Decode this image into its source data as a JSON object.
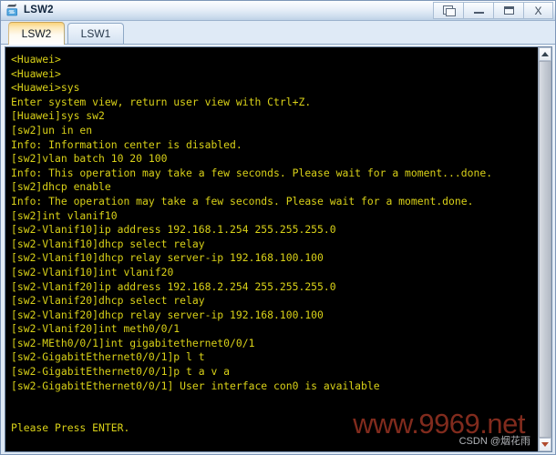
{
  "window": {
    "title": "LSW2",
    "icon": "switch-device-icon",
    "controls": [
      {
        "name": "restore-window-button",
        "glyph": "restore-icon",
        "label": ""
      },
      {
        "name": "minimize-window-button",
        "glyph": "minimize-icon",
        "label": ""
      },
      {
        "name": "maximize-window-button",
        "glyph": "maximize-icon",
        "label": ""
      },
      {
        "name": "close-window-button",
        "glyph": "close-icon",
        "label": "X"
      }
    ]
  },
  "tabs": [
    {
      "label": "LSW2",
      "active": true
    },
    {
      "label": "LSW1",
      "active": false
    }
  ],
  "terminal": {
    "foreground": "#d9d118",
    "background": "#000000",
    "lines": [
      "<Huawei>",
      "<Huawei>",
      "<Huawei>sys",
      "Enter system view, return user view with Ctrl+Z.",
      "[Huawei]sys sw2",
      "[sw2]un in en",
      "Info: Information center is disabled.",
      "[sw2]vlan batch 10 20 100",
      "Info: This operation may take a few seconds. Please wait for a moment...done.",
      "[sw2]dhcp enable",
      "Info: The operation may take a few seconds. Please wait for a moment.done.",
      "[sw2]int vlanif10",
      "[sw2-Vlanif10]ip address 192.168.1.254 255.255.255.0",
      "[sw2-Vlanif10]dhcp select relay",
      "[sw2-Vlanif10]dhcp relay server-ip 192.168.100.100",
      "[sw2-Vlanif10]int vlanif20",
      "[sw2-Vlanif20]ip address 192.168.2.254 255.255.255.0",
      "[sw2-Vlanif20]dhcp select relay",
      "[sw2-Vlanif20]dhcp relay server-ip 192.168.100.100",
      "[sw2-Vlanif20]int meth0/0/1",
      "[sw2-MEth0/0/1]int gigabitethernet0/0/1",
      "[sw2-GigabitEthernet0/0/1]p l t",
      "[sw2-GigabitEthernet0/0/1]p t a v a",
      "[sw2-GigabitEthernet0/0/1] User interface con0 is available",
      "",
      "",
      "Please Press ENTER."
    ]
  },
  "scrollbar": {
    "up_arrow": "scroll-up-arrow-icon",
    "down_arrow": "scroll-down-arrow-icon",
    "thumb_position": "top"
  },
  "watermarks": {
    "site": "www.9969.net",
    "site_color": "#8d2f20",
    "csdn": "CSDN @烟花雨",
    "csdn_color": "#c9ccd1"
  }
}
